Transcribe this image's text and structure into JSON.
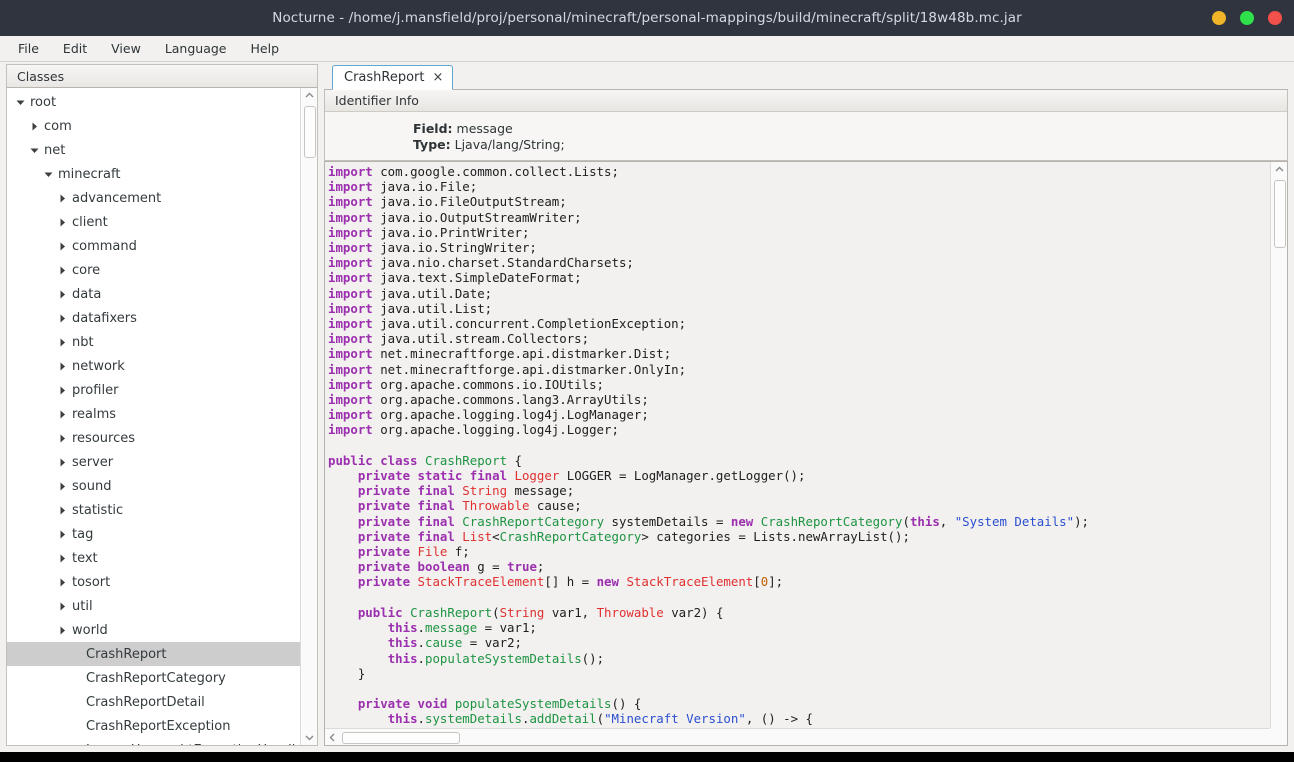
{
  "window": {
    "title": "Nocturne - /home/j.mansfield/proj/personal/minecraft/personal-mappings/build/minecraft/split/18w48b.mc.jar",
    "controls": {
      "minimize_color": "#f0b429",
      "maximize_color": "#2ee04a",
      "close_color": "#f2504b"
    },
    "titlebar_color": "#2f343f"
  },
  "menubar": {
    "items": [
      {
        "label": "File"
      },
      {
        "label": "Edit"
      },
      {
        "label": "View"
      },
      {
        "label": "Language"
      },
      {
        "label": "Help"
      }
    ]
  },
  "sidebar": {
    "header": "Classes",
    "tree": [
      {
        "label": "root",
        "depth": 0,
        "twisty": "down",
        "selected": false
      },
      {
        "label": "com",
        "depth": 1,
        "twisty": "right",
        "selected": false
      },
      {
        "label": "net",
        "depth": 1,
        "twisty": "down",
        "selected": false
      },
      {
        "label": "minecraft",
        "depth": 2,
        "twisty": "down",
        "selected": false
      },
      {
        "label": "advancement",
        "depth": 3,
        "twisty": "right",
        "selected": false
      },
      {
        "label": "client",
        "depth": 3,
        "twisty": "right",
        "selected": false
      },
      {
        "label": "command",
        "depth": 3,
        "twisty": "right",
        "selected": false
      },
      {
        "label": "core",
        "depth": 3,
        "twisty": "right",
        "selected": false
      },
      {
        "label": "data",
        "depth": 3,
        "twisty": "right",
        "selected": false
      },
      {
        "label": "datafixers",
        "depth": 3,
        "twisty": "right",
        "selected": false
      },
      {
        "label": "nbt",
        "depth": 3,
        "twisty": "right",
        "selected": false
      },
      {
        "label": "network",
        "depth": 3,
        "twisty": "right",
        "selected": false
      },
      {
        "label": "profiler",
        "depth": 3,
        "twisty": "right",
        "selected": false
      },
      {
        "label": "realms",
        "depth": 3,
        "twisty": "right",
        "selected": false
      },
      {
        "label": "resources",
        "depth": 3,
        "twisty": "right",
        "selected": false
      },
      {
        "label": "server",
        "depth": 3,
        "twisty": "right",
        "selected": false
      },
      {
        "label": "sound",
        "depth": 3,
        "twisty": "right",
        "selected": false
      },
      {
        "label": "statistic",
        "depth": 3,
        "twisty": "right",
        "selected": false
      },
      {
        "label": "tag",
        "depth": 3,
        "twisty": "right",
        "selected": false
      },
      {
        "label": "text",
        "depth": 3,
        "twisty": "right",
        "selected": false
      },
      {
        "label": "tosort",
        "depth": 3,
        "twisty": "right",
        "selected": false
      },
      {
        "label": "util",
        "depth": 3,
        "twisty": "right",
        "selected": false
      },
      {
        "label": "world",
        "depth": 3,
        "twisty": "right",
        "selected": false
      },
      {
        "label": "CrashReport",
        "depth": 4,
        "twisty": "none",
        "selected": true
      },
      {
        "label": "CrashReportCategory",
        "depth": 4,
        "twisty": "none",
        "selected": false
      },
      {
        "label": "CrashReportDetail",
        "depth": 4,
        "twisty": "none",
        "selected": false
      },
      {
        "label": "CrashReportException",
        "depth": 4,
        "twisty": "none",
        "selected": false
      },
      {
        "label": "LoggerUncaughtExceptionHandler",
        "depth": 4,
        "twisty": "none",
        "selected": false
      }
    ]
  },
  "editor": {
    "tab": {
      "label": "CrashReport",
      "close_glyph": "×"
    },
    "identifier_info": {
      "header": "Identifier Info",
      "field_key": "Field:",
      "field_value": "message",
      "type_key": "Type:",
      "type_value": "Ljava/lang/String;"
    },
    "code_lines": [
      [
        {
          "t": "import",
          "c": "kw"
        },
        {
          "t": " com.google.common.collect.Lists;",
          "c": "pl"
        }
      ],
      [
        {
          "t": "import",
          "c": "kw"
        },
        {
          "t": " java.io.File;",
          "c": "pl"
        }
      ],
      [
        {
          "t": "import",
          "c": "kw"
        },
        {
          "t": " java.io.FileOutputStream;",
          "c": "pl"
        }
      ],
      [
        {
          "t": "import",
          "c": "kw"
        },
        {
          "t": " java.io.OutputStreamWriter;",
          "c": "pl"
        }
      ],
      [
        {
          "t": "import",
          "c": "kw"
        },
        {
          "t": " java.io.PrintWriter;",
          "c": "pl"
        }
      ],
      [
        {
          "t": "import",
          "c": "kw"
        },
        {
          "t": " java.io.StringWriter;",
          "c": "pl"
        }
      ],
      [
        {
          "t": "import",
          "c": "kw"
        },
        {
          "t": " java.nio.charset.StandardCharsets;",
          "c": "pl"
        }
      ],
      [
        {
          "t": "import",
          "c": "kw"
        },
        {
          "t": " java.text.SimpleDateFormat;",
          "c": "pl"
        }
      ],
      [
        {
          "t": "import",
          "c": "kw"
        },
        {
          "t": " java.util.Date;",
          "c": "pl"
        }
      ],
      [
        {
          "t": "import",
          "c": "kw"
        },
        {
          "t": " java.util.List;",
          "c": "pl"
        }
      ],
      [
        {
          "t": "import",
          "c": "kw"
        },
        {
          "t": " java.util.concurrent.CompletionException;",
          "c": "pl"
        }
      ],
      [
        {
          "t": "import",
          "c": "kw"
        },
        {
          "t": " java.util.stream.Collectors;",
          "c": "pl"
        }
      ],
      [
        {
          "t": "import",
          "c": "kw"
        },
        {
          "t": " net.minecraftforge.api.distmarker.Dist;",
          "c": "pl"
        }
      ],
      [
        {
          "t": "import",
          "c": "kw"
        },
        {
          "t": " net.minecraftforge.api.distmarker.OnlyIn;",
          "c": "pl"
        }
      ],
      [
        {
          "t": "import",
          "c": "kw"
        },
        {
          "t": " org.apache.commons.io.IOUtils;",
          "c": "pl"
        }
      ],
      [
        {
          "t": "import",
          "c": "kw"
        },
        {
          "t": " org.apache.commons.lang3.ArrayUtils;",
          "c": "pl"
        }
      ],
      [
        {
          "t": "import",
          "c": "kw"
        },
        {
          "t": " org.apache.logging.log4j.LogManager;",
          "c": "pl"
        }
      ],
      [
        {
          "t": "import",
          "c": "kw"
        },
        {
          "t": " org.apache.logging.log4j.Logger;",
          "c": "pl"
        }
      ],
      [],
      [
        {
          "t": "public class",
          "c": "kw"
        },
        {
          "t": " ",
          "c": "pl"
        },
        {
          "t": "CrashReport",
          "c": "cls"
        },
        {
          "t": " {",
          "c": "pl"
        }
      ],
      [
        {
          "t": "    ",
          "c": "pl"
        },
        {
          "t": "private static final",
          "c": "kw"
        },
        {
          "t": " ",
          "c": "pl"
        },
        {
          "t": "Logger",
          "c": "type"
        },
        {
          "t": " LOGGER = LogManager.getLogger();",
          "c": "pl"
        }
      ],
      [
        {
          "t": "    ",
          "c": "pl"
        },
        {
          "t": "private final",
          "c": "kw"
        },
        {
          "t": " ",
          "c": "pl"
        },
        {
          "t": "String",
          "c": "type"
        },
        {
          "t": " message;",
          "c": "pl"
        }
      ],
      [
        {
          "t": "    ",
          "c": "pl"
        },
        {
          "t": "private final",
          "c": "kw"
        },
        {
          "t": " ",
          "c": "pl"
        },
        {
          "t": "Throwable",
          "c": "type"
        },
        {
          "t": " cause;",
          "c": "pl"
        }
      ],
      [
        {
          "t": "    ",
          "c": "pl"
        },
        {
          "t": "private final",
          "c": "kw"
        },
        {
          "t": " ",
          "c": "pl"
        },
        {
          "t": "CrashReportCategory",
          "c": "cls"
        },
        {
          "t": " systemDetails = ",
          "c": "pl"
        },
        {
          "t": "new",
          "c": "kw"
        },
        {
          "t": " ",
          "c": "pl"
        },
        {
          "t": "CrashReportCategory",
          "c": "cls"
        },
        {
          "t": "(",
          "c": "pl"
        },
        {
          "t": "this",
          "c": "kw"
        },
        {
          "t": ", ",
          "c": "pl"
        },
        {
          "t": "\"System Details\"",
          "c": "str"
        },
        {
          "t": ");",
          "c": "pl"
        }
      ],
      [
        {
          "t": "    ",
          "c": "pl"
        },
        {
          "t": "private final",
          "c": "kw"
        },
        {
          "t": " ",
          "c": "pl"
        },
        {
          "t": "List",
          "c": "type"
        },
        {
          "t": "<",
          "c": "pl"
        },
        {
          "t": "CrashReportCategory",
          "c": "cls"
        },
        {
          "t": "> categories = Lists.newArrayList();",
          "c": "pl"
        }
      ],
      [
        {
          "t": "    ",
          "c": "pl"
        },
        {
          "t": "private",
          "c": "kw"
        },
        {
          "t": " ",
          "c": "pl"
        },
        {
          "t": "File",
          "c": "type"
        },
        {
          "t": " f;",
          "c": "pl"
        }
      ],
      [
        {
          "t": "    ",
          "c": "pl"
        },
        {
          "t": "private boolean",
          "c": "kw"
        },
        {
          "t": " g = ",
          "c": "pl"
        },
        {
          "t": "true",
          "c": "kw"
        },
        {
          "t": ";",
          "c": "pl"
        }
      ],
      [
        {
          "t": "    ",
          "c": "pl"
        },
        {
          "t": "private",
          "c": "kw"
        },
        {
          "t": " ",
          "c": "pl"
        },
        {
          "t": "StackTraceElement",
          "c": "type"
        },
        {
          "t": "[] h = ",
          "c": "pl"
        },
        {
          "t": "new",
          "c": "kw"
        },
        {
          "t": " ",
          "c": "pl"
        },
        {
          "t": "StackTraceElement",
          "c": "type"
        },
        {
          "t": "[",
          "c": "pl"
        },
        {
          "t": "0",
          "c": "num"
        },
        {
          "t": "];",
          "c": "pl"
        }
      ],
      [],
      [
        {
          "t": "    ",
          "c": "pl"
        },
        {
          "t": "public",
          "c": "kw"
        },
        {
          "t": " ",
          "c": "pl"
        },
        {
          "t": "CrashReport",
          "c": "cls"
        },
        {
          "t": "(",
          "c": "pl"
        },
        {
          "t": "String",
          "c": "type"
        },
        {
          "t": " var1, ",
          "c": "pl"
        },
        {
          "t": "Throwable",
          "c": "type"
        },
        {
          "t": " var2) {",
          "c": "pl"
        }
      ],
      [
        {
          "t": "        ",
          "c": "pl"
        },
        {
          "t": "this",
          "c": "kw"
        },
        {
          "t": ".",
          "c": "pl"
        },
        {
          "t": "message",
          "c": "cls"
        },
        {
          "t": " = var1;",
          "c": "pl"
        }
      ],
      [
        {
          "t": "        ",
          "c": "pl"
        },
        {
          "t": "this",
          "c": "kw"
        },
        {
          "t": ".",
          "c": "pl"
        },
        {
          "t": "cause",
          "c": "cls"
        },
        {
          "t": " = var2;",
          "c": "pl"
        }
      ],
      [
        {
          "t": "        ",
          "c": "pl"
        },
        {
          "t": "this",
          "c": "kw"
        },
        {
          "t": ".",
          "c": "pl"
        },
        {
          "t": "populateSystemDetails",
          "c": "cls"
        },
        {
          "t": "();",
          "c": "pl"
        }
      ],
      [
        {
          "t": "    }",
          "c": "pl"
        }
      ],
      [],
      [
        {
          "t": "    ",
          "c": "pl"
        },
        {
          "t": "private void",
          "c": "kw"
        },
        {
          "t": " ",
          "c": "pl"
        },
        {
          "t": "populateSystemDetails",
          "c": "cls"
        },
        {
          "t": "() {",
          "c": "pl"
        }
      ],
      [
        {
          "t": "        ",
          "c": "pl"
        },
        {
          "t": "this",
          "c": "kw"
        },
        {
          "t": ".",
          "c": "pl"
        },
        {
          "t": "systemDetails",
          "c": "cls"
        },
        {
          "t": ".",
          "c": "pl"
        },
        {
          "t": "addDetail",
          "c": "cls"
        },
        {
          "t": "(",
          "c": "pl"
        },
        {
          "t": "\"Minecraft Version\"",
          "c": "str"
        },
        {
          "t": ", () -> {",
          "c": "pl"
        }
      ]
    ]
  },
  "colors": {
    "keyword": "#9b2fae",
    "type": "#e03030",
    "class_name": "#1e9442",
    "string": "#2b4fd0",
    "number": "#c06000",
    "code_background": "#f2f1f0",
    "selection": "#cdcdcd",
    "tab_border": "#5ba7d0"
  }
}
